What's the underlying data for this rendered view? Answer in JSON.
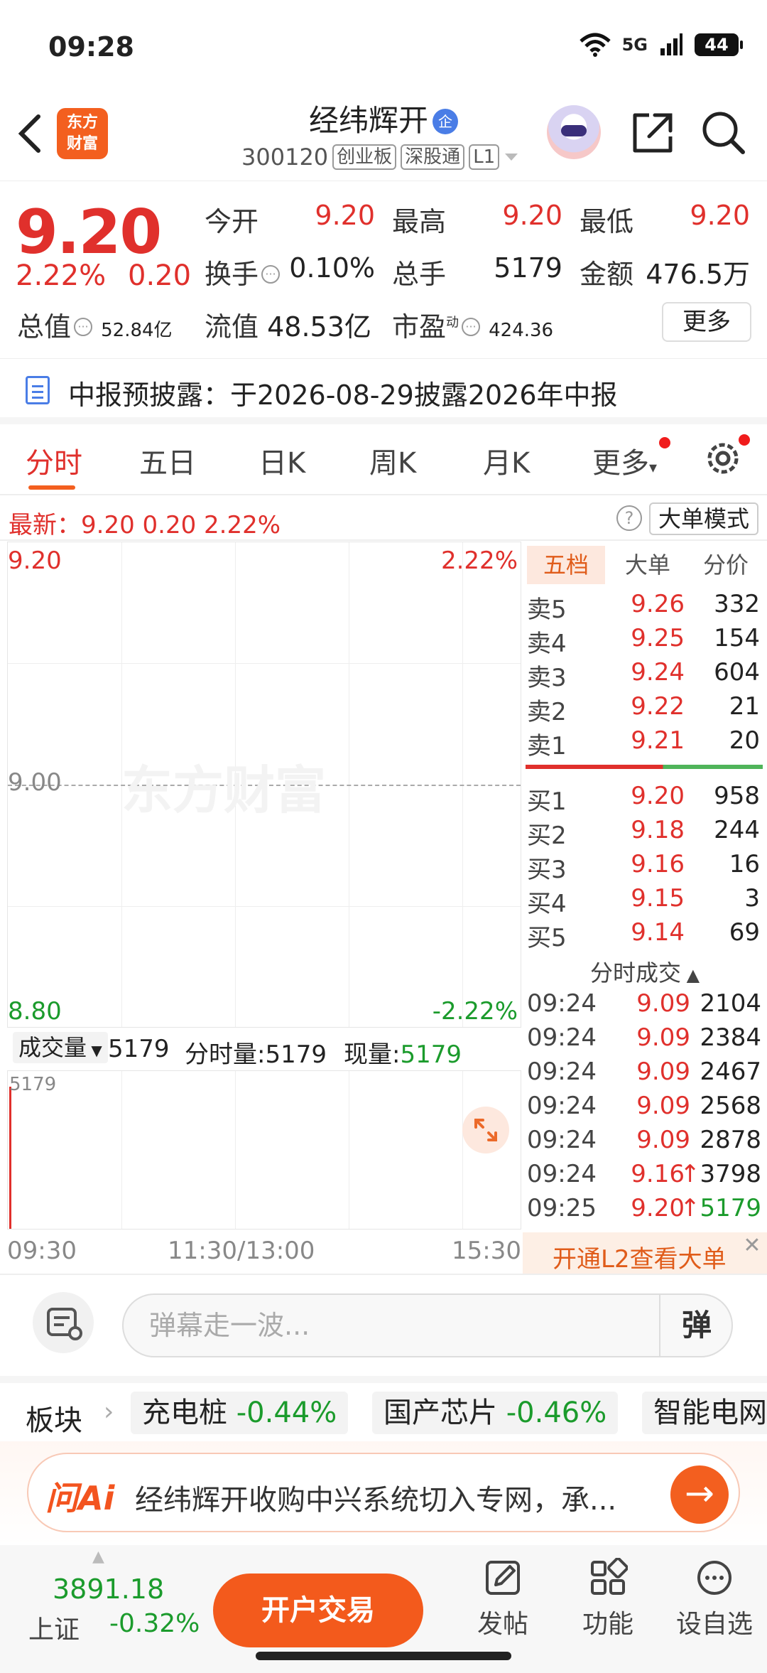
{
  "status_bar": {
    "time": "09:28",
    "network": "5G",
    "battery": "44"
  },
  "header": {
    "logo_text_1": "东方",
    "logo_text_2": "财富",
    "stock_name": "经纬辉开",
    "stock_badge": "企",
    "stock_code": "300120",
    "tags": [
      "创业板",
      "深股通",
      "L1"
    ]
  },
  "quote": {
    "price": "9.20",
    "change_pct": "2.22%",
    "change_amt": "0.20",
    "open_label": "今开",
    "open": "9.20",
    "high_label": "最高",
    "high": "9.20",
    "low_label": "最低",
    "low": "9.20",
    "turnover_label": "换手",
    "turnover": "0.10%",
    "volume_label": "总手",
    "volume": "5179",
    "amount_label": "金额",
    "amount": "476.5万",
    "mktcap_label": "总值",
    "mktcap": "52.84亿",
    "float_label": "流值",
    "float": "48.53亿",
    "pe_label": "市盈",
    "pe_super": "动",
    "pe": "424.36",
    "more_label": "更多"
  },
  "notice": {
    "text": "中报预披露：于2026-08-29披露2026年中报"
  },
  "tabs": [
    "分时",
    "五日",
    "日K",
    "周K",
    "月K",
    "更多"
  ],
  "latest_bar": {
    "text": "最新：9.20  0.20  2.22%",
    "help": "?",
    "big_order_mode": "大单模式"
  },
  "chart": {
    "top_price": "9.20",
    "top_pct": "2.22%",
    "mid_price": "9.00",
    "bottom_price": "8.80",
    "bottom_pct": "-2.22%",
    "watermark": "东方财富",
    "colors": {
      "up": "#e0302c",
      "down": "#1b9b2c",
      "accent": "#f35f1f"
    }
  },
  "volume": {
    "selector": "成交量",
    "total": "5179",
    "minute_label": "分时量:",
    "minute_value": "5179",
    "current_label": "现量:",
    "current_value": "5179",
    "axis_max": "5179"
  },
  "time_axis": [
    "09:30",
    "11:30/13:00",
    "15:30"
  ],
  "order_book": {
    "tabs": [
      "五档",
      "大单",
      "分价"
    ],
    "asks": [
      {
        "label": "卖5",
        "price": "9.26",
        "vol": "332"
      },
      {
        "label": "卖4",
        "price": "9.25",
        "vol": "154"
      },
      {
        "label": "卖3",
        "price": "9.24",
        "vol": "604"
      },
      {
        "label": "卖2",
        "price": "9.22",
        "vol": "21"
      },
      {
        "label": "卖1",
        "price": "9.21",
        "vol": "20"
      }
    ],
    "bids": [
      {
        "label": "买1",
        "price": "9.20",
        "vol": "958"
      },
      {
        "label": "买2",
        "price": "9.18",
        "vol": "244"
      },
      {
        "label": "买3",
        "price": "9.16",
        "vol": "16"
      },
      {
        "label": "买4",
        "price": "9.15",
        "vol": "3"
      },
      {
        "label": "买5",
        "price": "9.14",
        "vol": "69"
      }
    ],
    "ticks_title": "分时成交",
    "ticks": [
      {
        "time": "09:24",
        "price": "9.09",
        "arrow": "",
        "vol": "2104"
      },
      {
        "time": "09:24",
        "price": "9.09",
        "arrow": "",
        "vol": "2384"
      },
      {
        "time": "09:24",
        "price": "9.09",
        "arrow": "",
        "vol": "2467"
      },
      {
        "time": "09:24",
        "price": "9.09",
        "arrow": "",
        "vol": "2568"
      },
      {
        "time": "09:24",
        "price": "9.09",
        "arrow": "",
        "vol": "2878"
      },
      {
        "time": "09:24",
        "price": "9.16",
        "arrow": "↑",
        "vol": "3798"
      },
      {
        "time": "09:25",
        "price": "9.20",
        "arrow": "↑",
        "vol": "5179"
      }
    ],
    "l2_text": "开通L2查看大单",
    "l2_close": "✕"
  },
  "barrage": {
    "placeholder": "弹幕走一波...",
    "send": "弹"
  },
  "sectors": {
    "label": "板块",
    "items": [
      {
        "name": "充电桩",
        "change": "-0.44%"
      },
      {
        "name": "国产芯片",
        "change": "-0.46%"
      },
      {
        "name": "智能电网",
        "change": ""
      }
    ]
  },
  "ai": {
    "logo": "问Ai",
    "text": "经纬辉开收购中兴系统切入专网，承...",
    "go": "→"
  },
  "bottom_nav": {
    "index_value": "3891.18",
    "index_name": "上证",
    "index_change": "-0.32%",
    "trade_button": "开户交易",
    "items": [
      "发帖",
      "功能",
      "设自选"
    ]
  }
}
